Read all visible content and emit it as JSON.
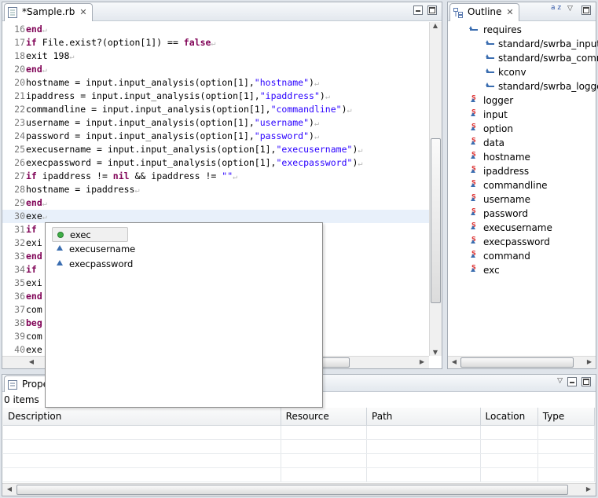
{
  "editor": {
    "tab_title": "*Sample.rb",
    "lines": [
      {
        "n": "16",
        "parts": [
          {
            "t": "end",
            "c": "kw"
          }
        ],
        "pil": true
      },
      {
        "n": "17",
        "parts": [
          {
            "t": "if",
            "c": "kw"
          },
          {
            "t": " File.exist?(option[1]) == ",
            "c": ""
          },
          {
            "t": "false",
            "c": "kw"
          }
        ],
        "pil": true
      },
      {
        "n": "18",
        "parts": [
          {
            "t": "exit 198",
            "c": ""
          }
        ],
        "pil": true
      },
      {
        "n": "20",
        "parts": [
          {
            "t": "end",
            "c": "kw"
          }
        ],
        "pil": true
      },
      {
        "n": "20",
        "parts": [
          {
            "t": "hostname = input.input_analysis(option[1],",
            "c": ""
          },
          {
            "t": "\"hostname\"",
            "c": "str"
          },
          {
            "t": ")",
            "c": ""
          }
        ],
        "pil": true
      },
      {
        "n": "21",
        "parts": [
          {
            "t": "ipaddress = input.input_analysis(option[1],",
            "c": ""
          },
          {
            "t": "\"ipaddress\"",
            "c": "str"
          },
          {
            "t": ")",
            "c": ""
          }
        ],
        "pil": true
      },
      {
        "n": "22",
        "parts": [
          {
            "t": "commandline = input.input_analysis(option[1],",
            "c": ""
          },
          {
            "t": "\"commandline\"",
            "c": "str"
          },
          {
            "t": ")",
            "c": ""
          }
        ],
        "pil": true
      },
      {
        "n": "23",
        "parts": [
          {
            "t": "username = input.input_analysis(option[1],",
            "c": ""
          },
          {
            "t": "\"username\"",
            "c": "str"
          },
          {
            "t": ")",
            "c": ""
          }
        ],
        "pil": true
      },
      {
        "n": "24",
        "parts": [
          {
            "t": "password = input.input_analysis(option[1],",
            "c": ""
          },
          {
            "t": "\"password\"",
            "c": "str"
          },
          {
            "t": ")",
            "c": ""
          }
        ],
        "pil": true
      },
      {
        "n": "25",
        "parts": [
          {
            "t": "execusername = input.input_analysis(option[1],",
            "c": ""
          },
          {
            "t": "\"execusername\"",
            "c": "str"
          },
          {
            "t": ")",
            "c": ""
          }
        ],
        "pil": true
      },
      {
        "n": "26",
        "parts": [
          {
            "t": "execpassword = input.input_analysis(option[1],",
            "c": ""
          },
          {
            "t": "\"execpassword\"",
            "c": "str"
          },
          {
            "t": ")",
            "c": ""
          }
        ],
        "pil": true
      },
      {
        "n": "27",
        "parts": [
          {
            "t": "if",
            "c": "kw"
          },
          {
            "t": " ipaddress != ",
            "c": ""
          },
          {
            "t": "nil",
            "c": "kw"
          },
          {
            "t": " && ipaddress != ",
            "c": ""
          },
          {
            "t": "\"\"",
            "c": "str"
          }
        ],
        "pil": true
      },
      {
        "n": "28",
        "parts": [
          {
            "t": "hostname = ipaddress",
            "c": ""
          }
        ],
        "pil": true
      },
      {
        "n": "29",
        "parts": [
          {
            "t": "end",
            "c": "kw"
          }
        ],
        "pil": true
      },
      {
        "n": "30",
        "parts": [
          {
            "t": "exe",
            "c": ""
          }
        ],
        "pil": true,
        "cur": true
      },
      {
        "n": "31",
        "parts": [
          {
            "t": "if",
            "c": "kw"
          }
        ],
        "pil": false
      },
      {
        "n": "32",
        "parts": [
          {
            "t": "exi",
            "c": ""
          }
        ],
        "pil": false
      },
      {
        "n": "33",
        "parts": [
          {
            "t": "end",
            "c": "kw"
          }
        ],
        "pil": false
      },
      {
        "n": "34",
        "parts": [
          {
            "t": "if",
            "c": "kw"
          }
        ],
        "pil": false
      },
      {
        "n": "35",
        "parts": [
          {
            "t": "exi",
            "c": ""
          }
        ],
        "pil": false
      },
      {
        "n": "36",
        "parts": [
          {
            "t": "end",
            "c": "kw"
          }
        ],
        "pil": false
      },
      {
        "n": "37",
        "parts": [
          {
            "t": "com",
            "c": ""
          }
        ],
        "pil": false
      },
      {
        "n": "38",
        "parts": [
          {
            "t": "beg",
            "c": "kw"
          }
        ],
        "pil": false
      },
      {
        "n": "39",
        "parts": [
          {
            "t": "com",
            "c": ""
          }
        ],
        "pil": false
      },
      {
        "n": "40",
        "parts": [
          {
            "t": "exe",
            "c": ""
          }
        ],
        "pil": false
      }
    ],
    "pilcrow": "↵"
  },
  "completion": {
    "items": [
      {
        "label": "exec",
        "icon": "method-dot-icon",
        "selected": true
      },
      {
        "label": "execusername",
        "icon": "variable-triangle-icon",
        "selected": false
      },
      {
        "label": "execpassword",
        "icon": "variable-triangle-icon",
        "selected": false
      }
    ]
  },
  "outline": {
    "tab_title": "Outline",
    "sort_glyph": "a z",
    "requires_label": "requires",
    "requires": [
      "standard/swrba_input",
      "standard/swrba_comm",
      "kconv",
      "standard/swrba_logger"
    ],
    "variables": [
      "logger",
      "input",
      "option",
      "data",
      "hostname",
      "ipaddress",
      "commandline",
      "username",
      "password",
      "execusername",
      "execpassword",
      "command",
      "exc"
    ]
  },
  "problems": {
    "tab_title": "Prope",
    "count_text": "0 items",
    "columns": [
      "Description",
      "Resource",
      "Path",
      "Location",
      "Type"
    ]
  },
  "colors": {
    "keyword": "#7f0055",
    "string": "#2a00ff",
    "current_line": "#e8f0fa"
  }
}
